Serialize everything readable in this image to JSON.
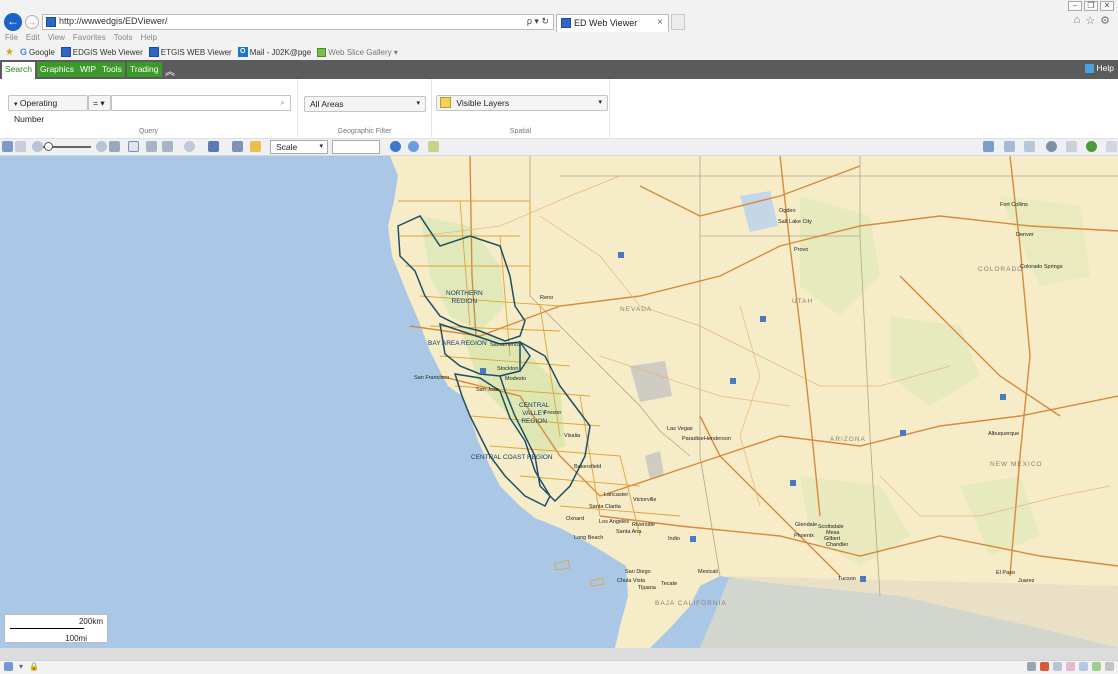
{
  "browser": {
    "address": "http://wwwedgis/EDViewer/",
    "address_controls": "ρ ▾ ↻",
    "tab_title": "ED Web Viewer",
    "tab_close": "×",
    "menu": [
      "File",
      "Edit",
      "View",
      "Favorites",
      "Tools",
      "Help"
    ],
    "favorites": [
      "Google",
      "EDGIS Web Viewer",
      "ETGIS WEB Viewer",
      "Mail - J02K@pge",
      "Web Slice Gallery ▾"
    ]
  },
  "app": {
    "tabs": [
      "Search",
      "Graphics",
      "WIP",
      "Tools",
      "Trading"
    ],
    "collapse_glyph": "︽",
    "help_label": "Help",
    "query": {
      "field_label": "Operating Number",
      "operator": "= ▾",
      "search_value": "",
      "section_label": "Query"
    },
    "geo_filter": {
      "value": "All Areas",
      "section_label": "Geographic Filter"
    },
    "spatial": {
      "value": "Visible Layers",
      "section_label": "Spatial"
    },
    "toolbar": {
      "scale_label": "Scale",
      "scale_value": ""
    }
  },
  "map": {
    "regions": [
      "NORTHERN\nREGION",
      "BAY AREA REGION",
      "CENTRAL\nVALLEY\nREGION",
      "CENTRAL COAST REGION"
    ],
    "states": [
      "NEVADA",
      "UTAH",
      "COLORADO",
      "ARIZONA",
      "NEW MEXICO",
      "BAJA CALIFORNIA"
    ],
    "cities": [
      "Ogden",
      "Salt Lake City",
      "Provo",
      "Denver",
      "Fort Collins",
      "Colorado Springs",
      "Sacramento",
      "San Francisco",
      "San Jose",
      "Stockton",
      "Modesto",
      "Fresno",
      "Visalia",
      "Bakersfield",
      "Las Vegas",
      "Paradise",
      "Henderson",
      "Lancaster",
      "Victorville",
      "Santa Clarita",
      "Oxnard",
      "Los Angeles",
      "Riverside",
      "Santa Ana",
      "Long Beach",
      "San Diego",
      "Chula Vista",
      "Tijuana",
      "Tecate",
      "Mexicali",
      "Phoenix",
      "Scottsdale",
      "Mesa",
      "Gilbert",
      "Chandler",
      "Glendale",
      "Tucson",
      "Albuquerque",
      "El Paso",
      "Juarez",
      "Reno",
      "Indio"
    ],
    "scalebar": {
      "top": "200km",
      "bottom": "100mi"
    }
  },
  "colors": {
    "app_tab_green": "#3a9a2a",
    "toolbar_grey": "#5b5b5b",
    "ocean": "#aac8e6",
    "land": "#f7ecc8",
    "highway": "#d78a3d",
    "region_boundary": "#1d4f66",
    "county_boundary": "#e0a436"
  }
}
